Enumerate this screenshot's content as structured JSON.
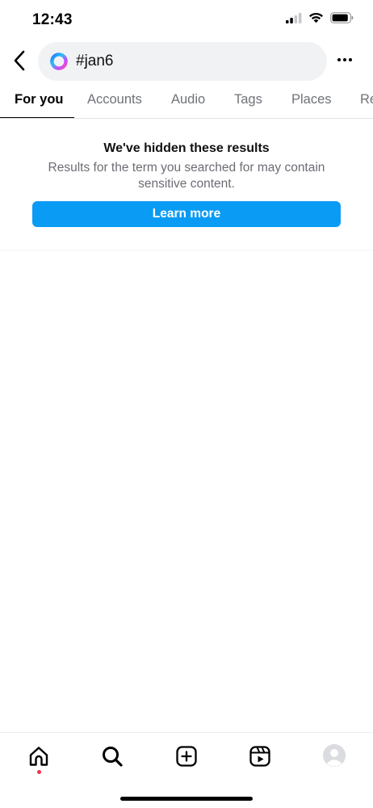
{
  "status_bar": {
    "time": "12:43",
    "icons": [
      "cellular-signal-icon",
      "wifi-icon",
      "battery-icon"
    ]
  },
  "search": {
    "icon": "meta-ai-ring-icon",
    "query": "#jan6",
    "back_icon": "chevron-left-icon",
    "more_icon": "more-horizontal-icon"
  },
  "tabs": [
    {
      "label": "For you",
      "active": true
    },
    {
      "label": "Accounts",
      "active": false
    },
    {
      "label": "Audio",
      "active": false
    },
    {
      "label": "Tags",
      "active": false
    },
    {
      "label": "Places",
      "active": false
    },
    {
      "label": "Re",
      "active": false
    }
  ],
  "notice": {
    "title": "We've hidden these results",
    "body": "Results for the term you searched for may contain sensitive content.",
    "button_label": "Learn more"
  },
  "bottom_nav": {
    "items": [
      "home-icon",
      "search-icon",
      "create-plus-icon",
      "reels-icon",
      "profile-avatar"
    ],
    "home_has_notification": true
  },
  "colors": {
    "accent_button": "#0a9bf5",
    "search_field_bg": "#f1f2f4",
    "muted_text": "#6a6d73",
    "notification_dot": "#ff2d55"
  }
}
